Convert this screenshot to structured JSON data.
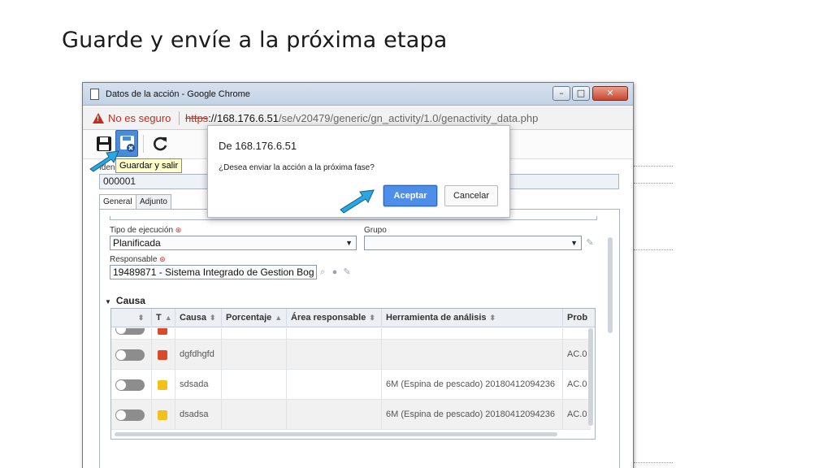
{
  "slide": {
    "title": "Guarde y envíe a la próxima etapa"
  },
  "window": {
    "title": "Datos de la acción - Google Chrome",
    "min_glyph": "–",
    "max_glyph": "□",
    "close_glyph": "✕"
  },
  "address_bar": {
    "warning": "No es seguro",
    "url_scheme": "https",
    "url_host": "://168.176.6.51",
    "url_path": "/se/v20479/generic/gn_activity/1.0/genactivity_data.php"
  },
  "toolbar": {
    "tooltip": "Guardar y salir"
  },
  "form": {
    "id_label": "Iden",
    "id_value": "000001",
    "tabs": [
      "General",
      "Adjunto"
    ],
    "tipo_label": "Tipo de ejecución",
    "tipo_value": "Planificada",
    "grupo_label": "Grupo",
    "grupo_value": "",
    "responsable_label": "Responsable",
    "responsable_value": "19489871 - Sistema Integrado de Gestion Bog",
    "required_mark": "⊛",
    "caret": "▼"
  },
  "causa": {
    "title": "Causa",
    "toggle_glyph": "▼",
    "columns": [
      "",
      "T",
      "Causa",
      "Porcentaje",
      "Área responsable",
      "Herramienta de análisis",
      "Prob"
    ],
    "sort_glyphs": [
      "⬍",
      "▲",
      "⬍",
      "▲",
      "⬍",
      "⬍",
      ""
    ],
    "rows": [
      {
        "type_color": "#d94a2b",
        "causa": "dgfdhgfd",
        "porcentaje": "",
        "area": "",
        "herramienta": "",
        "prob": "AC.0"
      },
      {
        "type_color": "#f2c21b",
        "causa": "sdsada",
        "porcentaje": "",
        "area": "",
        "herramienta": "6M (Espina de pescado) 20180412094236",
        "prob": "AC.0"
      },
      {
        "type_color": "#f2c21b",
        "causa": "dsadsa",
        "porcentaje": "",
        "area": "",
        "herramienta": "6M (Espina de pescado) 20180412094236",
        "prob": "AC.0"
      }
    ]
  },
  "dialog": {
    "title": "De 168.176.6.51",
    "message": "¿Desea enviar la acción a la próxima fase?",
    "ok_label": "Aceptar",
    "cancel_label": "Cancelar"
  },
  "colors": {
    "accent": "#4d8ee8",
    "warning": "#c62b1e",
    "hint_arrow": "#2aa6e0"
  }
}
